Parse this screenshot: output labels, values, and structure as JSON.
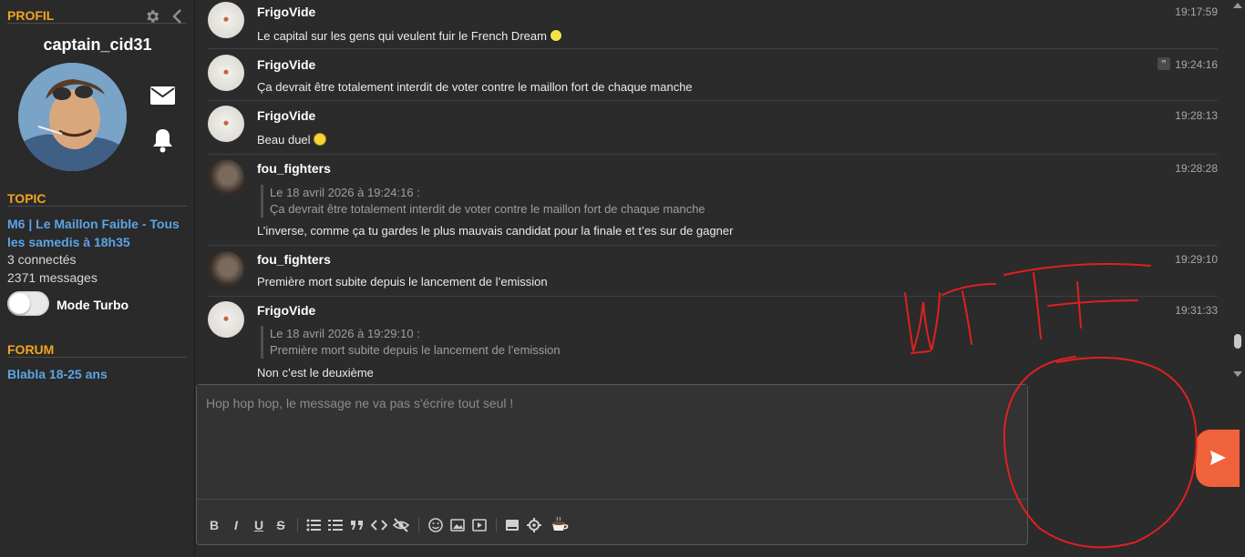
{
  "sidebar": {
    "profile_title": "PROFIL",
    "username": "captain_cid31",
    "topic_title": "TOPIC",
    "topic_name": "M6 | Le Maillon Faible - Tous les samedis à 18h35",
    "connected": "3 connectés",
    "messages_count": "2371 messages",
    "turbo_label": "Mode Turbo",
    "forum_title": "FORUM",
    "forum_name": "Blabla 18-25 ans"
  },
  "messages": [
    {
      "author": "FrigoVide",
      "time": "19:17:59",
      "text": "Le capital sur les gens qui veulent fuir le French Dream"
    },
    {
      "author": "FrigoVide",
      "time": "19:24:16",
      "text": "Ça devrait être totalement interdit de voter contre le maillon fort de chaque manche"
    },
    {
      "author": "FrigoVide",
      "time": "19:28:13",
      "text": "Beau duel"
    },
    {
      "author": "fou_fighters",
      "time": "19:28:28",
      "quote_header": "Le 18 avril 2026 à 19:24:16 :",
      "quote_text": "Ça devrait être totalement interdit de voter contre le maillon fort de chaque manche",
      "text": "L’inverse, comme ça tu gardes le plus mauvais candidat pour la finale et t’es sur de gagner"
    },
    {
      "author": "fou_fighters",
      "time": "19:29:10",
      "text": "Première mort subite depuis le lancement de l’emission"
    },
    {
      "author": "FrigoVide",
      "time": "19:31:33",
      "quote_header": "Le 18 avril 2026 à 19:29:10 :",
      "quote_text": "Première mort subite depuis le lancement de l’emission",
      "text": "Non c’est le deuxième"
    }
  ],
  "composer": {
    "placeholder": "Hop hop hop, le message ne va pas s'écrire tout seul !"
  },
  "toolbar": {
    "bold": "B",
    "italic": "I",
    "underline": "U",
    "strike": "S"
  },
  "colors": {
    "accent": "#f0a61e",
    "link": "#5ba4e6",
    "send": "#f0623a"
  },
  "icons": [
    "gear-icon",
    "chevron-left-icon",
    "mail-icon",
    "bell-icon",
    "send-icon",
    "quote-icon",
    "emoji-icon",
    "image-icon",
    "video-icon",
    "spoiler-icon",
    "settings-icon",
    "coffee-icon"
  ]
}
